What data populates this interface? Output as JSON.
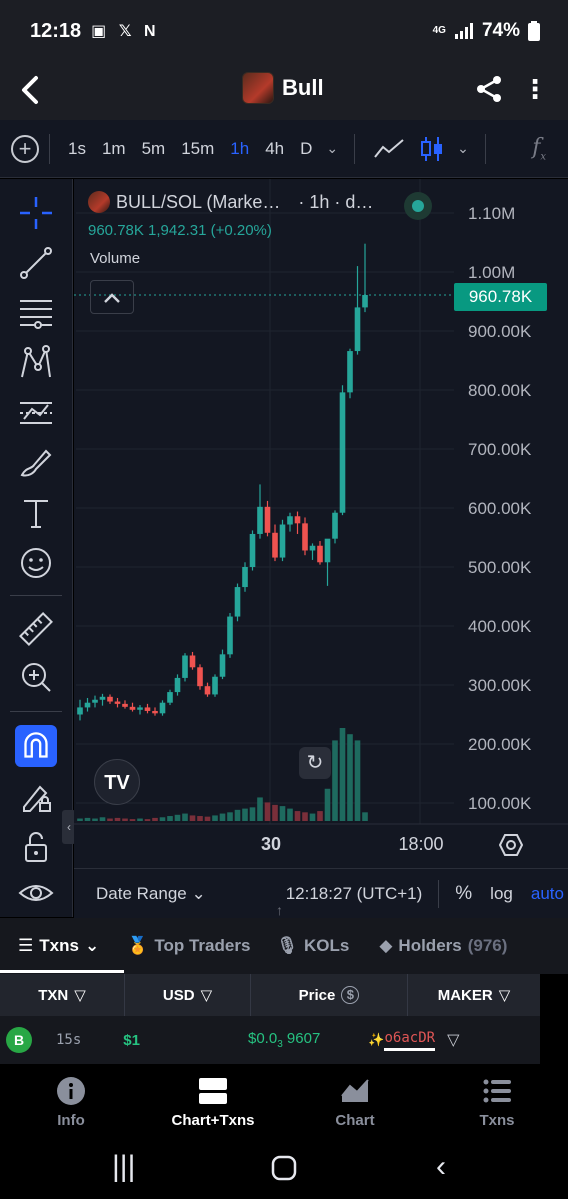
{
  "status_bar": {
    "time": "12:18",
    "notification_icons": "▣ 𝕏 N",
    "network": "4G",
    "battery": "74%"
  },
  "header": {
    "title": "Bull"
  },
  "timeframes": {
    "items": [
      "1s",
      "1m",
      "5m",
      "15m",
      "1h",
      "4h",
      "D"
    ],
    "active": "1h"
  },
  "chart": {
    "legend_title": "BULL/SOL (Marke…",
    "legend_interval": "· 1h · d…",
    "legend_values": "960.78K  1,942.31 (+0.20%)",
    "volume_label": "Volume",
    "last_price_tag": "960.78K",
    "footer": {
      "date_range": "Date Range",
      "clock": "12:18:27 (UTC+1)",
      "percent": "%",
      "log": "log",
      "auto": "auto"
    },
    "accent_up": "#26a69a",
    "accent_down": "#ef5350"
  },
  "chart_data": {
    "type": "candlestick",
    "title": "BULL/SOL (Marke…",
    "y_axis_ticks": [
      "1.10M",
      "1.00M",
      "900.00K",
      "800.00K",
      "700.00K",
      "600.00K",
      "500.00K",
      "400.00K",
      "300.00K",
      "200.00K",
      "100.00K"
    ],
    "ylim": [
      80000,
      1120000
    ],
    "x_axis_ticks": [
      "30",
      "18:00"
    ],
    "candles": [
      {
        "o": 250,
        "h": 275,
        "l": 240,
        "c": 262
      },
      {
        "o": 262,
        "h": 278,
        "l": 255,
        "c": 270
      },
      {
        "o": 270,
        "h": 282,
        "l": 262,
        "c": 275
      },
      {
        "o": 275,
        "h": 285,
        "l": 265,
        "c": 280
      },
      {
        "o": 280,
        "h": 284,
        "l": 268,
        "c": 272
      },
      {
        "o": 272,
        "h": 278,
        "l": 262,
        "c": 268
      },
      {
        "o": 268,
        "h": 274,
        "l": 260,
        "c": 263
      },
      {
        "o": 263,
        "h": 270,
        "l": 255,
        "c": 258
      },
      {
        "o": 258,
        "h": 266,
        "l": 250,
        "c": 262
      },
      {
        "o": 262,
        "h": 268,
        "l": 252,
        "c": 256
      },
      {
        "o": 256,
        "h": 262,
        "l": 248,
        "c": 252
      },
      {
        "o": 252,
        "h": 274,
        "l": 248,
        "c": 270
      },
      {
        "o": 270,
        "h": 292,
        "l": 266,
        "c": 288
      },
      {
        "o": 288,
        "h": 318,
        "l": 282,
        "c": 312
      },
      {
        "o": 312,
        "h": 354,
        "l": 306,
        "c": 350
      },
      {
        "o": 350,
        "h": 356,
        "l": 326,
        "c": 330
      },
      {
        "o": 330,
        "h": 335,
        "l": 292,
        "c": 298
      },
      {
        "o": 298,
        "h": 304,
        "l": 280,
        "c": 284
      },
      {
        "o": 284,
        "h": 318,
        "l": 280,
        "c": 314
      },
      {
        "o": 314,
        "h": 360,
        "l": 310,
        "c": 352
      },
      {
        "o": 352,
        "h": 422,
        "l": 346,
        "c": 416
      },
      {
        "o": 416,
        "h": 472,
        "l": 408,
        "c": 466
      },
      {
        "o": 466,
        "h": 508,
        "l": 458,
        "c": 500
      },
      {
        "o": 500,
        "h": 562,
        "l": 494,
        "c": 556
      },
      {
        "o": 556,
        "h": 640,
        "l": 548,
        "c": 602
      },
      {
        "o": 602,
        "h": 612,
        "l": 552,
        "c": 558
      },
      {
        "o": 558,
        "h": 572,
        "l": 510,
        "c": 516
      },
      {
        "o": 516,
        "h": 580,
        "l": 510,
        "c": 572
      },
      {
        "o": 572,
        "h": 592,
        "l": 560,
        "c": 586
      },
      {
        "o": 586,
        "h": 594,
        "l": 556,
        "c": 574
      },
      {
        "o": 574,
        "h": 584,
        "l": 520,
        "c": 528
      },
      {
        "o": 528,
        "h": 540,
        "l": 512,
        "c": 536
      },
      {
        "o": 536,
        "h": 544,
        "l": 504,
        "c": 508
      },
      {
        "o": 508,
        "h": 546,
        "l": 468,
        "c": 548
      },
      {
        "o": 548,
        "h": 596,
        "l": 540,
        "c": 592
      },
      {
        "o": 592,
        "h": 808,
        "l": 588,
        "c": 796
      },
      {
        "o": 796,
        "h": 870,
        "l": 786,
        "c": 866
      },
      {
        "o": 866,
        "h": 1010,
        "l": 860,
        "c": 940
      },
      {
        "o": 940,
        "h": 1048,
        "l": 932,
        "c": 961
      }
    ],
    "volumes": [
      4,
      5,
      4,
      6,
      4,
      5,
      4,
      3,
      4,
      3,
      5,
      6,
      8,
      10,
      12,
      9,
      8,
      7,
      9,
      12,
      14,
      18,
      20,
      22,
      38,
      30,
      26,
      24,
      20,
      16,
      14,
      12,
      16,
      52,
      130,
      150,
      140,
      130,
      14
    ],
    "volume_down": [
      false,
      false,
      false,
      false,
      true,
      true,
      true,
      true,
      false,
      true,
      true,
      false,
      false,
      false,
      false,
      true,
      true,
      true,
      false,
      false,
      false,
      false,
      false,
      false,
      false,
      true,
      true,
      false,
      false,
      true,
      true,
      false,
      true,
      false,
      false,
      false,
      false,
      false,
      false
    ]
  },
  "tabs": [
    {
      "label": "Txns",
      "active": true
    },
    {
      "label": "Top Traders"
    },
    {
      "label": "KOLs"
    },
    {
      "label": "Holders",
      "count": "(976)"
    }
  ],
  "table": {
    "headers": [
      "TXN",
      "USD",
      "Price",
      "MAKER"
    ],
    "rows": [
      {
        "type": "B",
        "age": "15s",
        "usd": "$1",
        "price_prefix": "$0.0",
        "price_sub": "3",
        "price_suffix": "9607",
        "maker": "o6acDR"
      }
    ]
  },
  "bottom_nav": [
    {
      "label": "Info"
    },
    {
      "label": "Chart+Txns",
      "active": true
    },
    {
      "label": "Chart"
    },
    {
      "label": "Txns"
    }
  ]
}
